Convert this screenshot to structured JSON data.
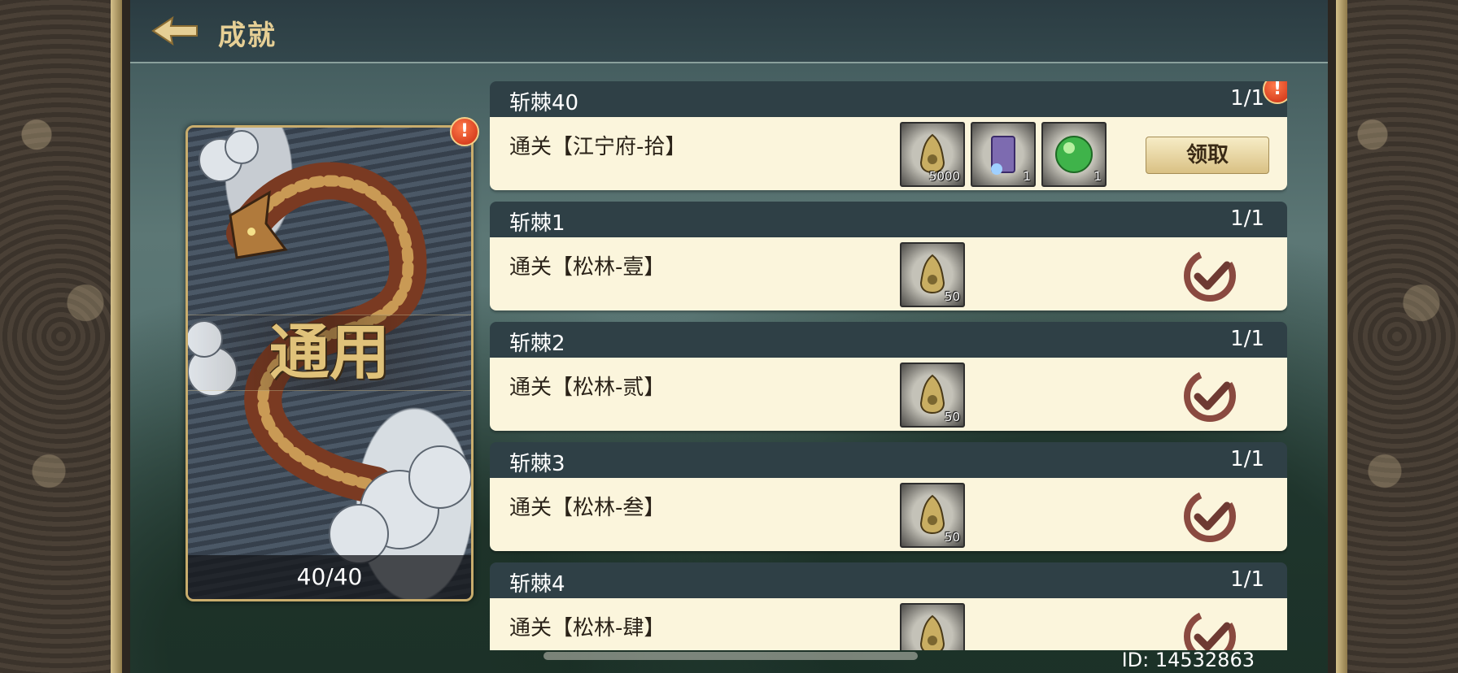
{
  "header": {
    "title": "成就"
  },
  "category": {
    "label": "通用",
    "count": "40/40"
  },
  "achievements": [
    {
      "name": "斩棘40",
      "progress": "1/1",
      "desc": "通关【江宁府-拾】",
      "rewards": [
        {
          "icon": "bell-token-icon",
          "qty": "5000"
        },
        {
          "icon": "scroll-item-icon",
          "qty": "1"
        },
        {
          "icon": "green-orb-icon",
          "qty": "1"
        }
      ],
      "claim_label": "领取"
    },
    {
      "name": "斩棘1",
      "progress": "1/1",
      "desc": "通关【松林-壹】",
      "rewards": [
        {
          "icon": "bell-token-icon",
          "qty": "50"
        }
      ]
    },
    {
      "name": "斩棘2",
      "progress": "1/1",
      "desc": "通关【松林-贰】",
      "rewards": [
        {
          "icon": "bell-token-icon",
          "qty": "50"
        }
      ]
    },
    {
      "name": "斩棘3",
      "progress": "1/1",
      "desc": "通关【松林-叁】",
      "rewards": [
        {
          "icon": "bell-token-icon",
          "qty": "50"
        }
      ]
    },
    {
      "name": "斩棘4",
      "progress": "1/1",
      "desc": "通关【松林-肆】",
      "rewards": [
        {
          "icon": "bell-token-icon",
          "qty": ""
        }
      ]
    }
  ],
  "footer": {
    "user_id": "ID: 14532863"
  },
  "colors": {
    "accent_gold": "#e6cf95",
    "row_header": "#2f4046",
    "row_body": "#fbf5dc",
    "alert_red": "#c92a10"
  }
}
